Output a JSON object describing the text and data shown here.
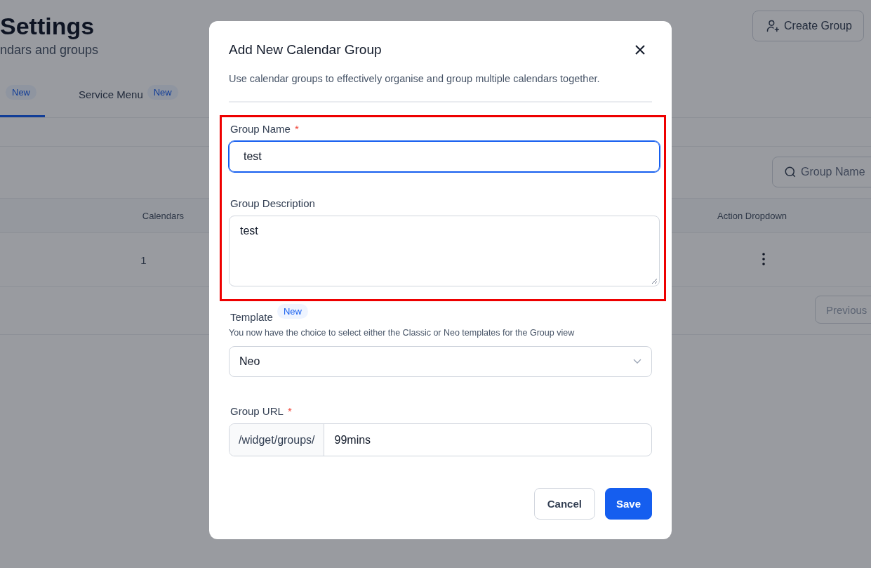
{
  "page": {
    "title": "Settings",
    "subtitle": "ndars and groups",
    "create_button": "Create Group"
  },
  "tabs": [
    {
      "badge": "New",
      "selected": true
    },
    {
      "label": "Service Menu",
      "badge": "New",
      "selected": false
    }
  ],
  "search": {
    "placeholder": "Group Name"
  },
  "table": {
    "columns": [
      "Calendars",
      "Action Dropdown"
    ],
    "rows": [
      {
        "calendars": "1"
      }
    ]
  },
  "pagination": {
    "previous": "Previous"
  },
  "dialog": {
    "title": "Add New Calendar Group",
    "description": "Use calendar groups to effectively organise and group multiple calendars together.",
    "highlighted": true,
    "fields": [
      {
        "kind": "text",
        "label": "Group Name",
        "required_mark": "*",
        "value": "test",
        "focused": true
      },
      {
        "kind": "textarea",
        "label": "Group Description",
        "value": "test",
        "focused": false
      },
      {
        "kind": "select",
        "label": "Template",
        "badge": "New",
        "hint": "You now have the choice to select either the Classic or Neo templates for the Group view",
        "value": "Neo"
      },
      {
        "kind": "prefixed",
        "label": "Group URL",
        "required_mark": "*",
        "prefix": "/widget/groups/",
        "value": "99mins"
      }
    ],
    "buttons": [
      {
        "label": "Cancel",
        "primary": false
      },
      {
        "label": "Save",
        "primary": true
      }
    ]
  }
}
